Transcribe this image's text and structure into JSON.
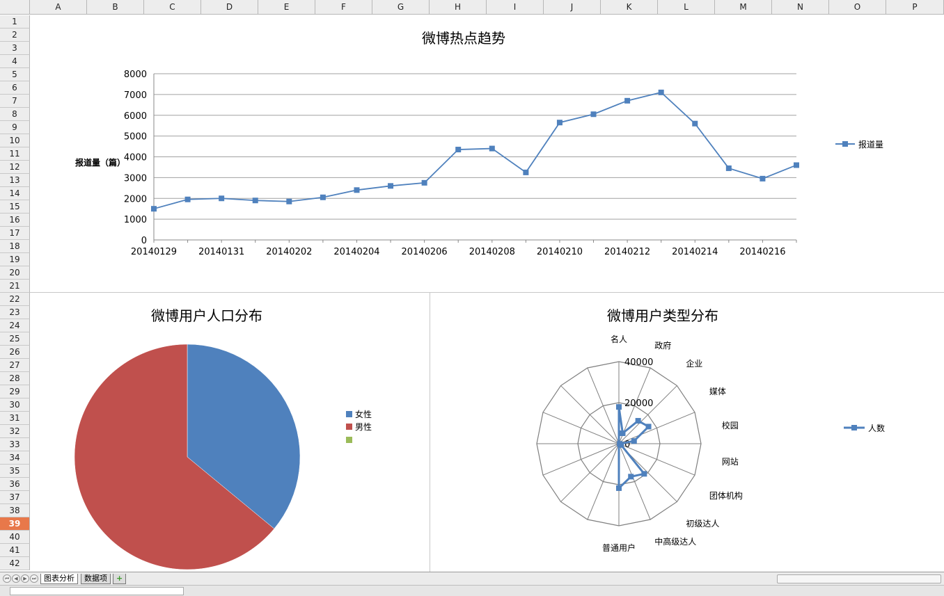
{
  "columns": [
    "A",
    "B",
    "C",
    "D",
    "E",
    "F",
    "G",
    "H",
    "I",
    "J",
    "K",
    "L",
    "M",
    "N",
    "O",
    "P"
  ],
  "rows": [
    "1",
    "2",
    "3",
    "4",
    "5",
    "6",
    "7",
    "8",
    "9",
    "10",
    "11",
    "12",
    "13",
    "14",
    "15",
    "16",
    "17",
    "18",
    "19",
    "20",
    "21",
    "22",
    "23",
    "24",
    "25",
    "26",
    "27",
    "28",
    "29",
    "30",
    "31",
    "32",
    "33",
    "34",
    "35",
    "36",
    "37",
    "38",
    "39",
    "40",
    "41",
    "42"
  ],
  "active_row": "39",
  "sheet_tabs": {
    "tab1": "图表分析",
    "tab2": "数据项",
    "add": "+"
  },
  "colors": {
    "blue": "#4f81bd",
    "red": "#c0504d",
    "green": "#9bbb59",
    "active_row": "#e8784a"
  },
  "chart_data": [
    {
      "type": "line",
      "title": "微博热点趋势",
      "ylabel": "报道量（篇）",
      "xlabel": "",
      "ylim": [
        0,
        8000
      ],
      "yticks": [
        0,
        1000,
        2000,
        3000,
        4000,
        5000,
        6000,
        7000,
        8000
      ],
      "x": [
        "20140129",
        "20140130",
        "20140131",
        "20140201",
        "20140202",
        "20140203",
        "20140204",
        "20140205",
        "20140206",
        "20140207",
        "20140208",
        "20140209",
        "20140210",
        "20140211",
        "20140212",
        "20140213",
        "20140214",
        "20140215",
        "20140216",
        "20140217"
      ],
      "xtick_labels": [
        "20140129",
        "20140131",
        "20140202",
        "20140204",
        "20140206",
        "20140208",
        "20140210",
        "20140212",
        "20140214",
        "20140216"
      ],
      "series": [
        {
          "name": "报道量",
          "values": [
            1500,
            1950,
            2000,
            1900,
            1850,
            2050,
            2400,
            2600,
            2750,
            4350,
            4400,
            3250,
            5650,
            6050,
            6700,
            7100,
            5600,
            3450,
            2950,
            3600
          ]
        }
      ],
      "legend": "right",
      "grid": true
    },
    {
      "type": "pie",
      "title": "微博用户人口分布",
      "slices": [
        {
          "name": "女性",
          "value": 36
        },
        {
          "name": "男性",
          "value": 64
        }
      ],
      "legend_entries": [
        "女性",
        "男性",
        ""
      ],
      "legend": "right"
    },
    {
      "type": "radar",
      "title": "微博用户类型分布",
      "categories": [
        "名人",
        "政府",
        "企业",
        "媒体",
        "校园",
        "网站",
        "团体机构",
        "初级达人",
        "中高级达人",
        "普通用户"
      ],
      "radial_ticks": [
        "0",
        "20000",
        "40000"
      ],
      "rmax": 48000,
      "series": [
        {
          "name": "人数",
          "values": [
            21500,
            6500,
            17500,
            20000,
            9000,
            500,
            1500,
            23000,
            20500,
            26000
          ]
        }
      ],
      "legend": "right"
    }
  ]
}
